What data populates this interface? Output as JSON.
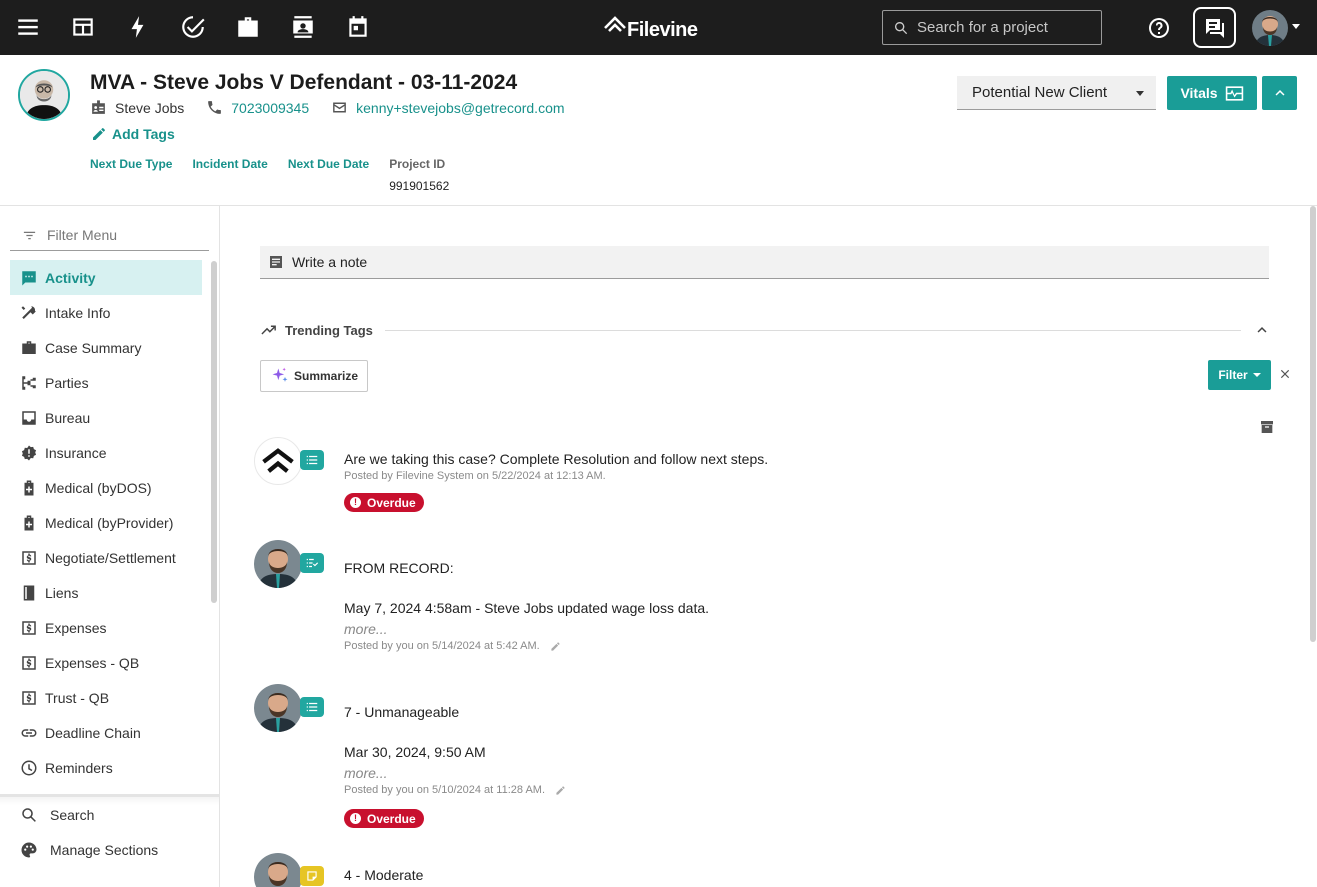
{
  "brand": {
    "name": "Filevine",
    "accent": "#1a9d97"
  },
  "topbar": {
    "search_placeholder": "Search for a project",
    "icons": [
      "menu-icon",
      "dashboard-icon",
      "bolt-icon",
      "tasks-check-icon",
      "briefcase-icon",
      "contacts-icon",
      "calendar-icon"
    ]
  },
  "project": {
    "title": "MVA - Steve Jobs V Defendant - 03-11-2024",
    "client_name": "Steve Jobs",
    "phone": "7023009345",
    "email": "kenny+stevejobs@getrecord.com",
    "add_tags_label": "Add Tags",
    "fields": [
      {
        "label": "Next Due Type",
        "value": ""
      },
      {
        "label": "Incident Date",
        "value": ""
      },
      {
        "label": "Next Due Date",
        "value": ""
      },
      {
        "label": "Project ID",
        "value": "991901562"
      }
    ],
    "status": "Potential New Client",
    "vitals_label": "Vitals"
  },
  "sidebar": {
    "filter_placeholder": "Filter Menu",
    "items": [
      {
        "label": "Activity",
        "icon": "chat-dots-icon",
        "active": true
      },
      {
        "label": "Intake Info",
        "icon": "tools-icon"
      },
      {
        "label": "Case Summary",
        "icon": "briefcase-icon"
      },
      {
        "label": "Parties",
        "icon": "parties-tree-icon"
      },
      {
        "label": "Bureau",
        "icon": "inbox-icon"
      },
      {
        "label": "Insurance",
        "icon": "badge-alert-icon"
      },
      {
        "label": "Medical (byDOS)",
        "icon": "medical-bag-icon"
      },
      {
        "label": "Medical (byProvider)",
        "icon": "medical-bag-icon"
      },
      {
        "label": "Negotiate/Settlement",
        "icon": "dollar-box-icon"
      },
      {
        "label": "Liens",
        "icon": "book-icon"
      },
      {
        "label": "Expenses",
        "icon": "dollar-box-icon"
      },
      {
        "label": "Expenses - QB",
        "icon": "dollar-box-icon"
      },
      {
        "label": "Trust - QB",
        "icon": "dollar-box-icon"
      },
      {
        "label": "Deadline Chain",
        "icon": "link-icon"
      },
      {
        "label": "Reminders",
        "icon": "clock-icon"
      }
    ],
    "bottom": [
      {
        "label": "Search",
        "icon": "search-icon"
      },
      {
        "label": "Manage Sections",
        "icon": "palette-icon"
      }
    ]
  },
  "main": {
    "note_placeholder": "Write a note",
    "trending_label": "Trending Tags",
    "summarize_label": "Summarize",
    "filter_label": "Filter",
    "posts": [
      {
        "lines": [
          "Are we taking this case? Complete Resolution and follow next steps."
        ],
        "more": "",
        "meta": "Posted by Filevine System on 5/22/2024 at 12:13 AM.",
        "badge": "Overdue"
      },
      {
        "lines": [
          "FROM RECORD:",
          "May 7, 2024 4:58am - Steve Jobs updated wage loss data."
        ],
        "more": "more...",
        "meta": "Posted by you on 5/14/2024 at 5:42 AM.",
        "badge": ""
      },
      {
        "lines": [
          "7 - Unmanageable",
          "Mar 30, 2024, 9:50 AM"
        ],
        "more": "more...",
        "meta": "Posted by you on 5/10/2024 at 11:28 AM.",
        "badge": "Overdue"
      },
      {
        "lines": [
          "4 - Moderate"
        ],
        "more": "",
        "meta": "",
        "badge": ""
      }
    ]
  }
}
